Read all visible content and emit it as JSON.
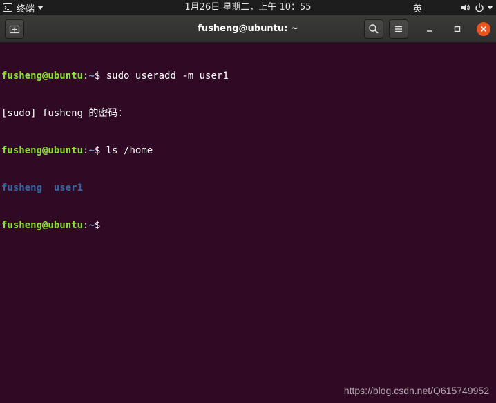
{
  "topbar": {
    "app_name": "终端",
    "clock": "1月26日 星期二，上午 10：55",
    "input_method": "英",
    "icons": [
      "terminal-icon",
      "caret-down-icon",
      "volume-icon",
      "power-icon",
      "caret-down-icon"
    ]
  },
  "window": {
    "title": "fusheng@ubuntu: ~",
    "buttons": {
      "new_tab": "new-tab-icon",
      "search": "search-icon",
      "menu": "hamburger-menu-icon",
      "minimize": "minimize-icon",
      "maximize": "maximize-icon",
      "close": "close-icon"
    }
  },
  "terminal": {
    "lines": [
      {
        "user": "fusheng@ubuntu",
        "sep": ":",
        "path": "~",
        "dollar": "$ ",
        "cmd": "sudo useradd -m user1"
      },
      {
        "text": "[sudo] fusheng 的密码："
      },
      {
        "user": "fusheng@ubuntu",
        "sep": ":",
        "path": "~",
        "dollar": "$ ",
        "cmd": "ls /home"
      },
      {
        "dirs": [
          "fusheng",
          "user1"
        ],
        "dir_gap": "  "
      },
      {
        "user": "fusheng@ubuntu",
        "sep": ":",
        "path": "~",
        "dollar": "$",
        "cmd": ""
      }
    ]
  },
  "watermark": "https://blog.csdn.net/Q615749952",
  "colors": {
    "terminal_bg": "#300a24",
    "prompt_user": "#8ae234",
    "prompt_path": "#729fcf",
    "directory": "#3465a4",
    "close_button": "#e95420",
    "topbar_bg": "#1d1d1d"
  }
}
